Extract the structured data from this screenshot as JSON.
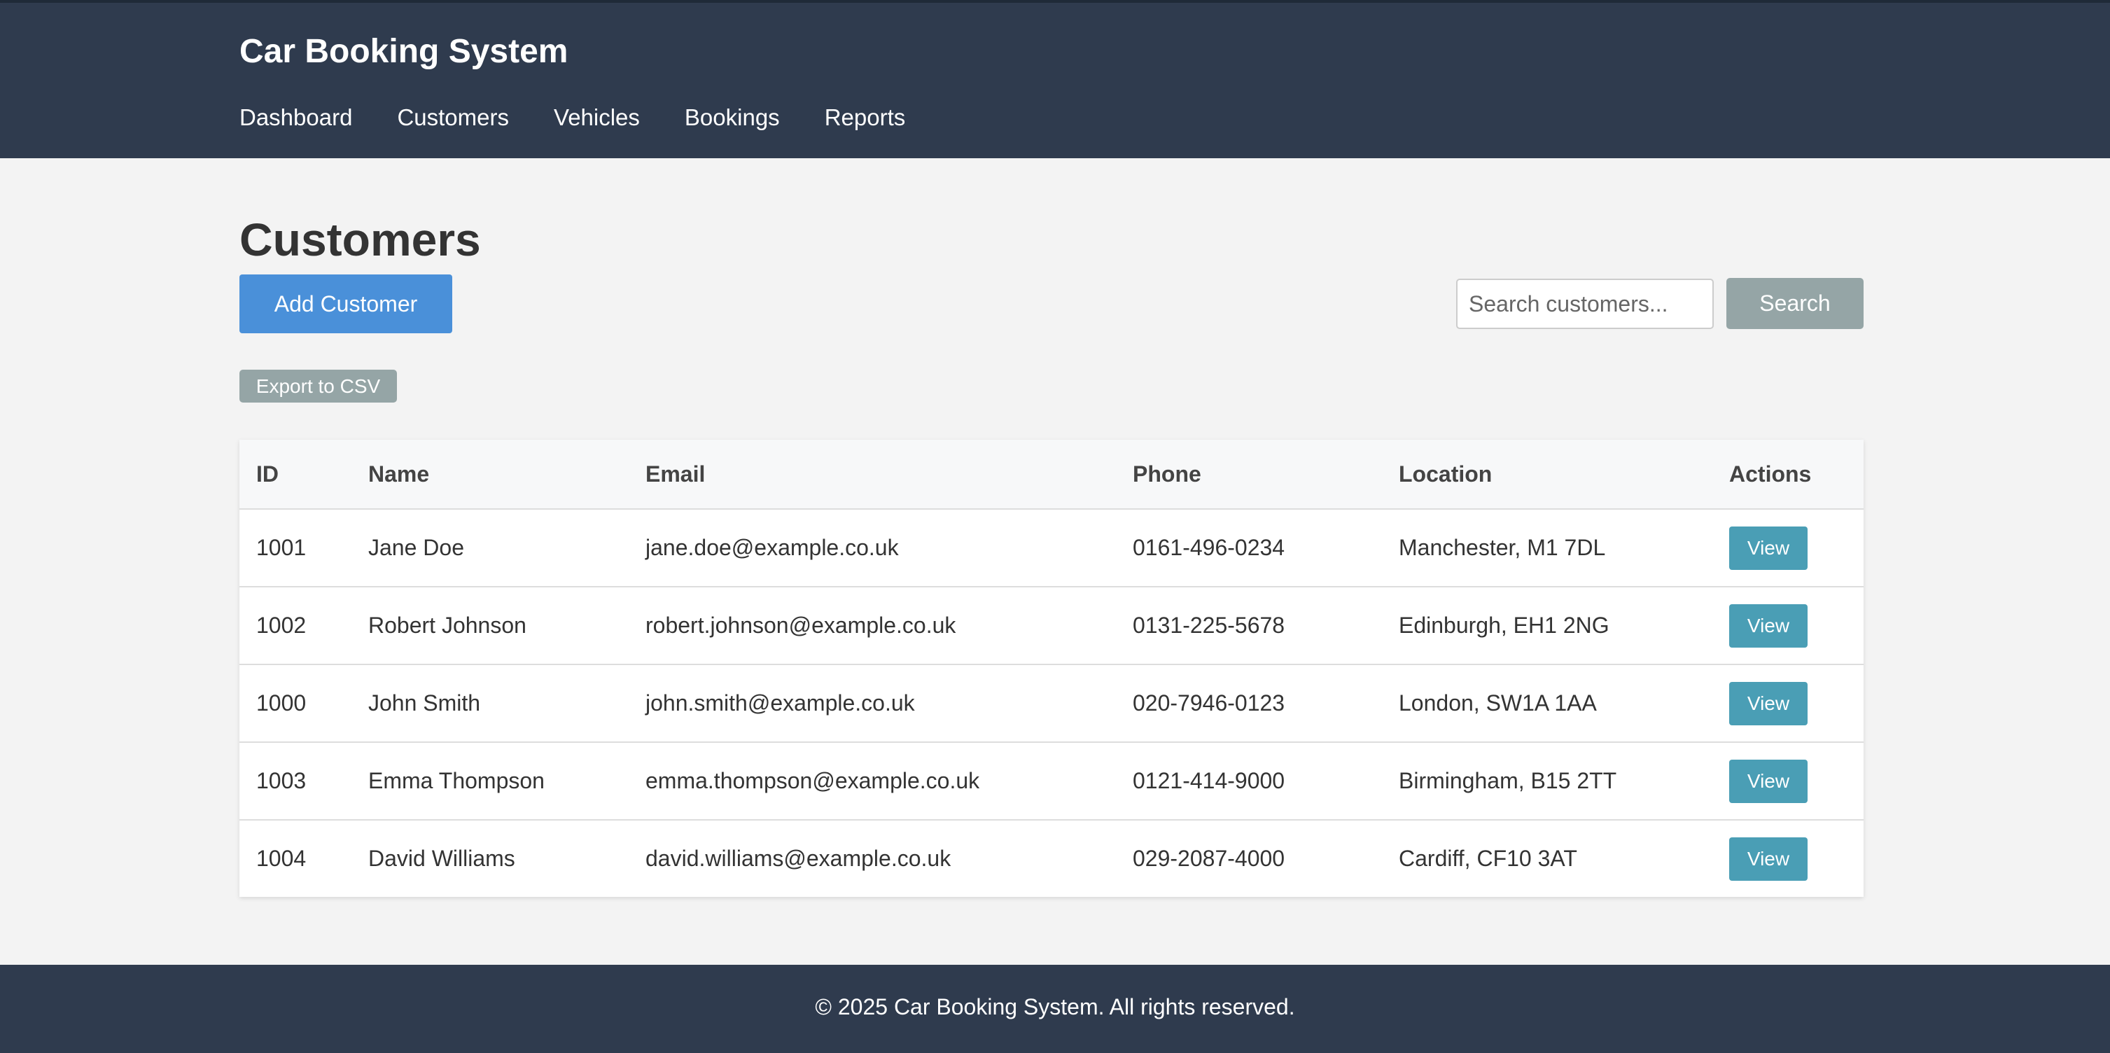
{
  "header": {
    "brand": "Car Booking System",
    "nav": [
      {
        "label": "Dashboard"
      },
      {
        "label": "Customers"
      },
      {
        "label": "Vehicles"
      },
      {
        "label": "Bookings"
      },
      {
        "label": "Reports"
      }
    ]
  },
  "main": {
    "title": "Customers",
    "add_button": "Add Customer",
    "search": {
      "placeholder": "Search customers...",
      "value": "",
      "button": "Search"
    },
    "export_button": "Export to CSV"
  },
  "table": {
    "columns": [
      "ID",
      "Name",
      "Email",
      "Phone",
      "Location",
      "Actions"
    ],
    "rows": [
      {
        "id": "1001",
        "name": "Jane Doe",
        "email": "jane.doe@example.co.uk",
        "phone": "0161-496-0234",
        "location": "Manchester, M1 7DL",
        "action": "View"
      },
      {
        "id": "1002",
        "name": "Robert Johnson",
        "email": "robert.johnson@example.co.uk",
        "phone": "0131-225-5678",
        "location": "Edinburgh, EH1 2NG",
        "action": "View"
      },
      {
        "id": "1000",
        "name": "John Smith",
        "email": "john.smith@example.co.uk",
        "phone": "020-7946-0123",
        "location": "London, SW1A 1AA",
        "action": "View"
      },
      {
        "id": "1003",
        "name": "Emma Thompson",
        "email": "emma.thompson@example.co.uk",
        "phone": "0121-414-9000",
        "location": "Birmingham, B15 2TT",
        "action": "View"
      },
      {
        "id": "1004",
        "name": "David Williams",
        "email": "david.williams@example.co.uk",
        "phone": "029-2087-4000",
        "location": "Cardiff, CF10 3AT",
        "action": "View"
      }
    ]
  },
  "footer": {
    "text": "© 2025 Car Booking System. All rights reserved."
  },
  "colors": {
    "header_bg": "#2f3b4e",
    "page_bg": "#f3f3f3",
    "primary_button": "#4a90d9",
    "secondary_button": "#95a5a6",
    "view_button": "#4a9eb5"
  }
}
